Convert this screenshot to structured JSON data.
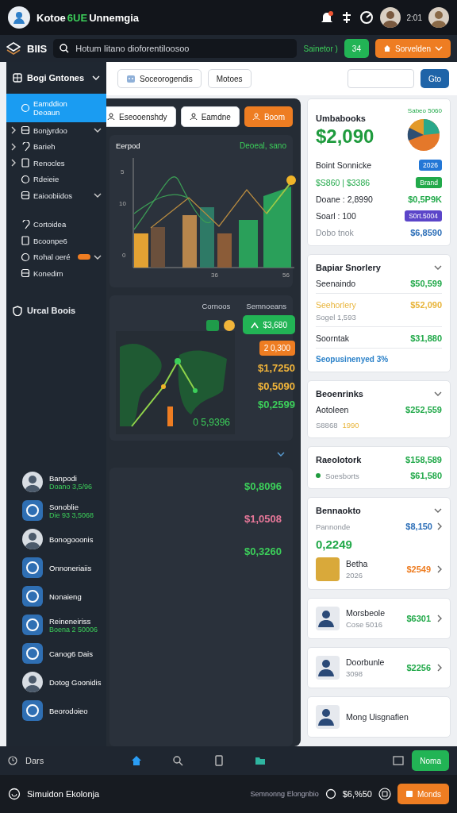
{
  "app_bar": {
    "title": "Kotoe",
    "title_highlight": "6UE",
    "title_end": "Unnemgia",
    "time": "2:01"
  },
  "toolbar": {
    "brand": "BlIS",
    "search": {
      "placeholder": "Hotum Iitano dioforentiloosoo"
    },
    "status": "Sainetor )",
    "count_button": "34",
    "menu_button": "Sorvelden"
  },
  "sidebar": {
    "title": "Bogi Gntones",
    "items": [
      {
        "label": "Eamddion",
        "sublabel": "Deoaun",
        "selected": true,
        "collapsed": false,
        "has_submenu": false,
        "badge": false
      },
      {
        "label": "Bonjyrdoo",
        "selected": false,
        "collapsed": true,
        "has_submenu": true,
        "badge": false
      },
      {
        "label": "Barieh",
        "selected": false,
        "collapsed": true,
        "has_submenu": false,
        "badge": false
      },
      {
        "label": "Renocles",
        "selected": false,
        "collapsed": true,
        "has_submenu": false,
        "badge": false
      },
      {
        "label": "Rdeieie",
        "selected": false,
        "collapsed": false,
        "has_submenu": false,
        "badge": false
      },
      {
        "label": "Eaioobiidos",
        "selected": false,
        "collapsed": false,
        "has_submenu": true,
        "badge": false
      },
      {
        "label": "Cortoidea",
        "selected": false,
        "collapsed": false,
        "has_submenu": false,
        "badge": false
      },
      {
        "label": "Bcoonpe6",
        "selected": false,
        "collapsed": false,
        "has_submenu": false,
        "badge": false
      },
      {
        "label": "Rohal oeré",
        "selected": false,
        "collapsed": false,
        "has_submenu": true,
        "badge": true
      },
      {
        "label": "Konedim",
        "selected": false,
        "collapsed": false,
        "has_submenu": false,
        "badge": false
      }
    ],
    "section_title": "Urcal Boois",
    "people": [
      {
        "name": "Banpodi",
        "detail": "Doano 3,5/96",
        "kind": "person"
      },
      {
        "name": "Sonoblie",
        "detail": "Die 93 3,5068",
        "kind": "object"
      },
      {
        "name": "Bonogooonis",
        "kind": "person"
      },
      {
        "name": "Onnoneriaiis",
        "kind": "object"
      },
      {
        "name": "Nonaieng",
        "kind": "object"
      },
      {
        "name": "Reineneiriss",
        "detail": "Boena 2 50006",
        "kind": "object"
      },
      {
        "name": "Canog6 Dais",
        "kind": "object"
      },
      {
        "name": "Dotog Goonidis",
        "kind": "person"
      },
      {
        "name": "Beorodoieo",
        "kind": "object"
      }
    ]
  },
  "main_toolbar": {
    "buttons": [
      "Soceorogendis",
      "Motoes"
    ],
    "go_button": "Gto"
  },
  "panel": {
    "actions": [
      {
        "label": "Eseooenshdy",
        "kind": "light"
      },
      {
        "label": "Eamdne",
        "kind": "light"
      },
      {
        "label": "Boom",
        "kind": "accent"
      }
    ],
    "chart_card": {
      "title": "Eerpod",
      "value": "Deoeal, sano",
      "y_labels": [
        "5",
        "10",
        "0"
      ],
      "x_labels": [
        "36",
        "56"
      ]
    },
    "map_card": {
      "headers": [
        "Cornoos",
        "Semnoeans"
      ],
      "green_button": "$3,680",
      "orange_badge": "2 0,300",
      "map_value": "0 5,9396",
      "values": [
        {
          "text": "$1,7250",
          "color": "#f2b53a"
        },
        {
          "text": "$0,5090",
          "color": "#f2b53a"
        },
        {
          "text": "$0,2599",
          "color": "#3ccf5a"
        }
      ]
    },
    "values": [
      {
        "text": "$0,8096",
        "color": "#3ccf5a"
      },
      {
        "text": "$1,0508",
        "color": "#e8789a"
      },
      {
        "text": "$0,3260",
        "color": "#3ccf5a"
      }
    ]
  },
  "summary_card": {
    "title": "Umbabooks",
    "tag": "Sabeo 5060",
    "amount": "$2,090",
    "rows": [
      {
        "kind": "badge",
        "label": "Boint  Sonnicke",
        "badge": "2026",
        "color": "#2377d6",
        "accent": false,
        "muted": false
      },
      {
        "kind": "badge",
        "label": "$S860 | $3386",
        "badge": "Brand",
        "color": "#22a94a",
        "accent": true,
        "muted": false
      },
      {
        "kind": "value",
        "label": "Doane : 2,8990",
        "value": "$0,5P9K",
        "color": "#22a94a",
        "accent": false,
        "muted": false
      },
      {
        "kind": "badge",
        "label": "Soarl : 100",
        "badge": "S0rt.5004",
        "color": "#5b45c9",
        "accent": false,
        "muted": false
      },
      {
        "kind": "value",
        "label": "Dobo tnok",
        "value": "$6,8590",
        "color": "#2d6fb8",
        "accent": false,
        "muted": true
      }
    ]
  },
  "history_card": {
    "title": "Bapiar Snorlery",
    "rows": [
      {
        "label": "Seenaindo",
        "value": "$50,599",
        "color": "#22a94a",
        "highlight": false
      },
      {
        "label": "Seehorlery",
        "value": "$52,090",
        "color": "#e8b43a",
        "highlight": true,
        "note": "Sogel 1,593"
      },
      {
        "label": "Soorntak",
        "value": "$31,880",
        "color": "#22a94a",
        "highlight": false
      }
    ],
    "footer": "Seopusinenyed 3%"
  },
  "links_card": {
    "title": "Beoenrinks",
    "label": "Aotoleen",
    "value": "$252,559",
    "note": "S8868",
    "note_highlight": "1990"
  },
  "stats_card": {
    "title": "Raeolotork",
    "value": "$158,589",
    "label": "Soesborts",
    "second_value": "$61,580"
  },
  "payments_card": {
    "title": "Bennaokto",
    "label": "Pannonde",
    "value": "$8,150",
    "amount": "0,2249",
    "items": [
      {
        "name": "Betha",
        "detail": "2026",
        "amount": "$2549",
        "color": "#ee7d22"
      }
    ]
  },
  "contacts": [
    {
      "name": "Morsbeole",
      "detail": "Cose 5016",
      "amount": "$6301",
      "color": "#22a94a"
    },
    {
      "name": "Doorbunle",
      "detail": "3098",
      "amount": "$2256",
      "color": "#22a94a"
    },
    {
      "name": "Mong Uisgnafien"
    }
  ],
  "bottom_nav": {
    "label": "Dars",
    "tabs": [
      {
        "selected": true
      },
      {
        "selected": false
      },
      {
        "selected": false
      },
      {
        "selected": false
      }
    ],
    "button": "Noma"
  },
  "footer": {
    "title": "Simuidon Ekolonja",
    "note": "Semnonng Elongnbio",
    "amount": "$6,%50",
    "button": "Monds"
  }
}
